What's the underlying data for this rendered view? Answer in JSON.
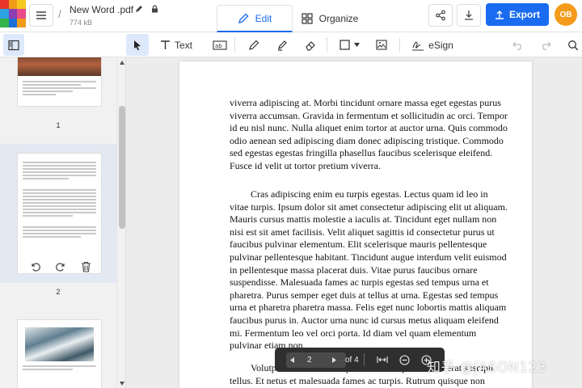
{
  "header": {
    "file_name": "New Word .pdf",
    "file_size": "774 kB",
    "tabs": {
      "edit": "Edit",
      "organize": "Organize"
    },
    "export_label": "Export",
    "avatar_initials": "OB",
    "colors": {
      "accent": "#1a6bf0",
      "avatar": "#f49b1c"
    }
  },
  "toolbar": {
    "text_label": "Text",
    "esign_label": "eSign",
    "icons": [
      "sidebar-toggle-icon",
      "select-arrow-icon",
      "text-icon",
      "replace-text-icon",
      "pen-icon",
      "highlighter-icon",
      "eraser-icon",
      "rectangle-icon",
      "image-icon",
      "esign-icon",
      "undo-icon",
      "redo-icon",
      "search-icon"
    ]
  },
  "sidebar": {
    "pages": [
      {
        "number": "1"
      },
      {
        "number": "2"
      }
    ]
  },
  "document": {
    "paragraphs": [
      "viverra adipiscing at. Morbi tincidunt ornare massa eget egestas purus viverra accumsan. Gravida in fermentum et sollicitudin ac orci. Tempor id eu nisl nunc. Nulla aliquet enim tortor at auctor urna. Quis commodo odio aenean sed adipiscing diam donec adipiscing tristique. Commodo sed egestas egestas fringilla phasellus faucibus scelerisque eleifend. Fusce id velit ut tortor pretium viverra.",
      "Cras adipiscing enim eu turpis egestas. Lectus quam id leo in vitae turpis. Ipsum dolor sit amet consectetur adipiscing elit ut aliquam. Mauris cursus mattis molestie a iaculis at. Tincidunt eget nullam non nisi est sit amet facilisis. Velit aliquet sagittis id consectetur purus ut faucibus pulvinar elementum. Elit scelerisque mauris pellentesque pulvinar pellentesque habitant. Tincidunt augue interdum velit euismod in pellentesque massa placerat duis. Vitae purus faucibus ornare suspendisse. Malesuada fames ac turpis egestas sed tempus urna et pharetra. Purus semper eget duis at tellus at urna. Egestas sed tempus urna et pharetra pharetra massa. Felis eget nunc lobortis mattis aliquam faucibus purus in. Auctor urna nunc id cursus metus aliquam eleifend mi. Fermentum leo vel orci porta. Id diam vel quam elementum pulvinar etiam non.",
      "Volutpat maecenas volutpat blandit aliquam etiam erat suscipit tellus. Et netus et malesuada fames ac turpis. Rutrum quisque non tellus orci"
    ]
  },
  "page_nav": {
    "current_page": "2",
    "of_total": "of 4"
  },
  "watermark": "知乎 @JASON123"
}
